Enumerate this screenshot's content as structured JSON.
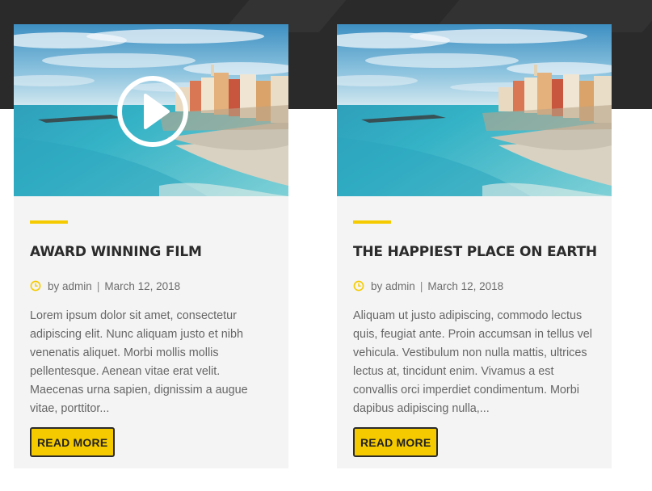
{
  "colors": {
    "accent": "#f5cb00",
    "dark_band": "#2a2a2b",
    "card_bg": "#f4f4f4",
    "title": "#2b2b2b",
    "text": "#666666"
  },
  "posts": [
    {
      "title": "AWARD WINNING FILM",
      "meta": {
        "by": "by",
        "author": "admin",
        "separator": "|",
        "date": "March 12, 2018"
      },
      "excerpt": "Lorem ipsum dolor sit amet, consectetur adipiscing elit. Nunc aliquam justo et nibh venenatis aliquet. Morbi mollis mollis pellentesque. Aenean vitae erat velit. Maecenas urna sapien, dignissim a augue vitae, porttitor...",
      "button": "READ MORE",
      "has_video": true,
      "icons": {
        "media": "play-icon",
        "meta": "clock-icon"
      }
    },
    {
      "title": "THE HAPPIEST PLACE ON EARTH",
      "meta": {
        "by": "by",
        "author": "admin",
        "separator": "|",
        "date": "March 12, 2018"
      },
      "excerpt": "Aliquam ut justo adipiscing, commodo lectus quis, feugiat ante. Proin accumsan in tellus vel vehicula. Vestibulum non nulla mattis, ultrices lectus at, tincidunt enim. Vivamus a est convallis orci imperdiet condimentum. Morbi dapibus adipiscing nulla,...",
      "button": "READ MORE",
      "has_video": false,
      "icons": {
        "meta": "clock-icon"
      }
    }
  ]
}
